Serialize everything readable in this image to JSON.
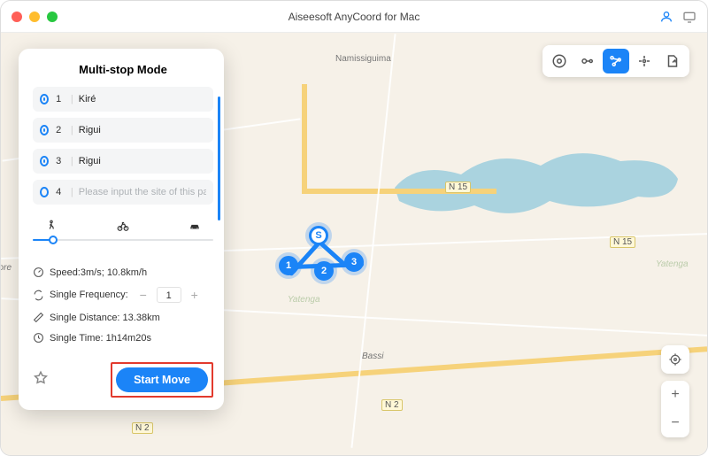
{
  "title": "Aiseesoft AnyCoord for Mac",
  "panel_title": "Multi-stop Mode",
  "stops": [
    {
      "num": "1",
      "value": "Kiré"
    },
    {
      "num": "2",
      "value": "Rigui"
    },
    {
      "num": "3",
      "value": "Rigui"
    },
    {
      "num": "4",
      "value": "",
      "placeholder": "Please input the site of this pat"
    }
  ],
  "info": {
    "speed": "Speed:3m/s; 10.8km/h",
    "freq_label": "Single Frequency:",
    "freq_value": "1",
    "distance": "Single Distance: 13.38km",
    "time": "Single Time: 1h14m20s"
  },
  "start_button": "Start Move",
  "map_labels": {
    "n15_a": "N 15",
    "n15_b": "N 15",
    "n2_a": "N 2",
    "n2_b": "N 2",
    "place_nami": "Namissiguima",
    "place_bassi": "Bassi",
    "place_yatenga": "Yatenga",
    "place_yatenga2": "Yatenga",
    "place_pore": "pore"
  },
  "route_nodes": {
    "S": "S",
    "n1": "1",
    "n2": "2",
    "n3": "3"
  },
  "symbols": {
    "plus": "+",
    "minus": "−",
    "plus2": "+",
    "minus2": "−"
  }
}
